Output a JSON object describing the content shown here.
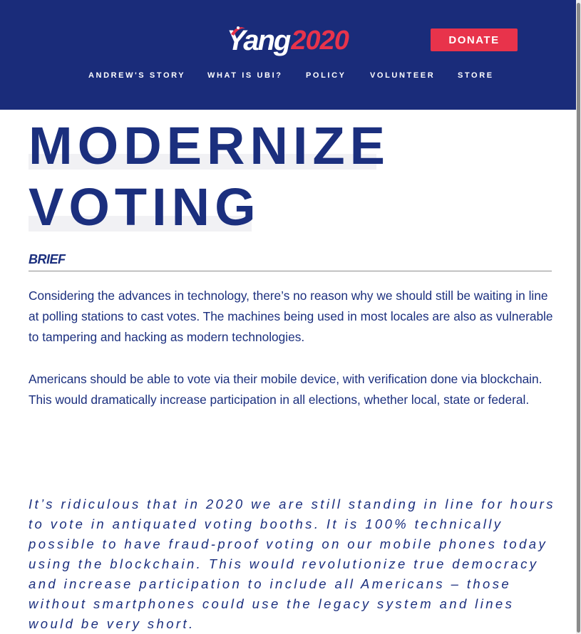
{
  "header": {
    "logo": {
      "name": "Yang",
      "year": "2020"
    },
    "donate_label": "DONATE",
    "nav": [
      {
        "label": "ANDREW'S STORY"
      },
      {
        "label": "WHAT IS UBI?"
      },
      {
        "label": "POLICY"
      },
      {
        "label": "VOLUNTEER"
      },
      {
        "label": "STORE"
      }
    ]
  },
  "main": {
    "title_line1": "MODERNIZE",
    "title_line2": "VOTING",
    "brief_label": "BRIEF",
    "paragraphs": [
      "Considering the advances in technology, there’s no reason why we should still be waiting in line at polling stations to cast votes. The machines being used in most locales are also as vulnerable to tampering and hacking as modern technologies.",
      "Americans should be able to vote via their mobile device, with verification done via blockchain. This would dramatically increase participation in all elections, whether local, state or federal."
    ],
    "quote": "It’s ridiculous that in 2020 we are still standing in line for hours to vote in antiquated voting booths. It is 100% technically possible to have fraud-proof voting on our mobile phones today using the blockchain. This would revolutionize true democracy and increase participation to include all Americans – those without smartphones could use the legacy system and lines would be very short."
  },
  "colors": {
    "brand_navy": "#1a2c7a",
    "accent_red": "#e8334b",
    "text_navy": "#1b2f7e"
  },
  "icons": {
    "logo_flag": "flag-swoosh-icon"
  }
}
